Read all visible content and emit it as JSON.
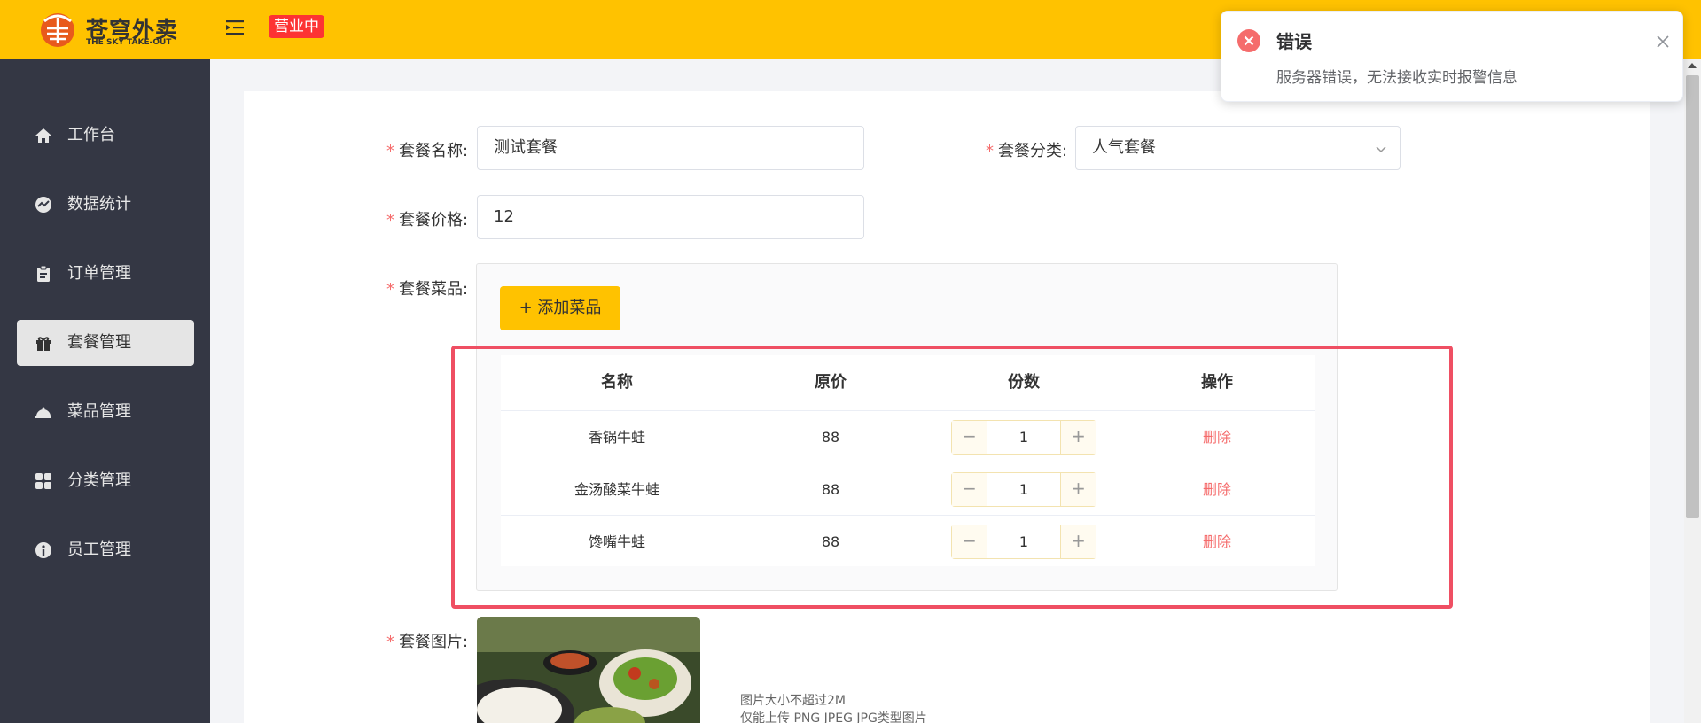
{
  "header": {
    "logo_title": "苍穹外卖",
    "logo_subtitle": "THE SKY TAKE-OUT",
    "status": "营业中",
    "brand_color": "#ffc200"
  },
  "sidebar": {
    "items": [
      {
        "label": "工作台",
        "icon": "home-icon"
      },
      {
        "label": "数据统计",
        "icon": "chart-icon"
      },
      {
        "label": "订单管理",
        "icon": "clipboard-icon"
      },
      {
        "label": "套餐管理",
        "icon": "gift-icon",
        "active": true
      },
      {
        "label": "菜品管理",
        "icon": "cloche-icon"
      },
      {
        "label": "分类管理",
        "icon": "grid-icon"
      },
      {
        "label": "员工管理",
        "icon": "employee-icon"
      }
    ]
  },
  "form": {
    "name_label": "套餐名称:",
    "name_value": "测试套餐",
    "category_label": "套餐分类:",
    "category_value": "人气套餐",
    "price_label": "套餐价格:",
    "price_value": "12",
    "dishes_label": "套餐菜品:",
    "add_dish_button": "+ 添加菜品",
    "image_label": "套餐图片:",
    "required_mark": "*",
    "image_hint_1": "图片大小不超过2M",
    "image_hint_2": "仅能上传 PNG JPEG JPG类型图片"
  },
  "dish_table": {
    "headers": [
      "名称",
      "原价",
      "份数",
      "操作"
    ],
    "rows": [
      {
        "name": "香锅牛蛙",
        "price": "88",
        "qty": "1",
        "action": "删除"
      },
      {
        "name": "金汤酸菜牛蛙",
        "price": "88",
        "qty": "1",
        "action": "删除"
      },
      {
        "name": "馋嘴牛蛙",
        "price": "88",
        "qty": "1",
        "action": "删除"
      }
    ]
  },
  "notification": {
    "title": "错误",
    "message": "服务器错误，无法接收实时报警信息",
    "icon": "error-circle-icon",
    "color": "#f56c6c"
  }
}
